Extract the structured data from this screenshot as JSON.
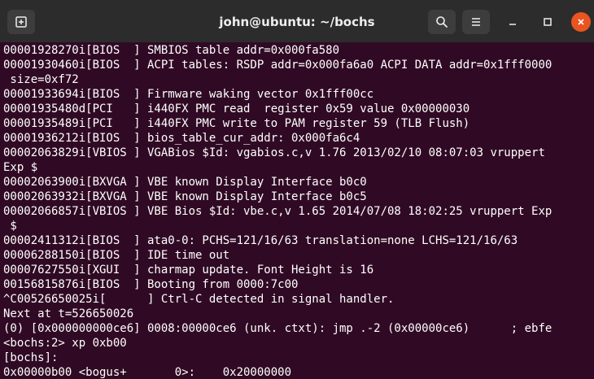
{
  "window": {
    "title": "john@ubuntu: ~/bochs",
    "accent_close": "#e95420",
    "background": "#300a24",
    "titlebar_background": "#2c2c2c"
  },
  "titlebar": {
    "buttons": [
      {
        "name": "new-tab-button",
        "icon": "new-tab-icon"
      },
      {
        "name": "search-button",
        "icon": "search-icon"
      },
      {
        "name": "hamburger-menu-button",
        "icon": "hamburger-menu-icon"
      },
      {
        "name": "minimize-button",
        "icon": "minimize-icon"
      },
      {
        "name": "maximize-button",
        "icon": "maximize-icon"
      },
      {
        "name": "close-button",
        "icon": "close-icon"
      }
    ]
  },
  "terminal": {
    "lines": [
      "00001928270i[BIOS  ] SMBIOS table addr=0x000fa580",
      "00001930460i[BIOS  ] ACPI tables: RSDP addr=0x000fa6a0 ACPI DATA addr=0x1fff0000",
      " size=0xf72",
      "00001933694i[BIOS  ] Firmware waking vector 0x1fff00cc",
      "00001935480d[PCI   ] i440FX PMC read  register 0x59 value 0x00000030",
      "00001935489i[PCI   ] i440FX PMC write to PAM register 59 (TLB Flush)",
      "00001936212i[BIOS  ] bios_table_cur_addr: 0x000fa6c4",
      "00002063829i[VBIOS ] VGABios $Id: vgabios.c,v 1.76 2013/02/10 08:07:03 vruppert",
      "Exp $",
      "00002063900i[BXVGA ] VBE known Display Interface b0c0",
      "00002063932i[BXVGA ] VBE known Display Interface b0c5",
      "00002066857i[VBIOS ] VBE Bios $Id: vbe.c,v 1.65 2014/07/08 18:02:25 vruppert Exp",
      " $",
      "00002411312i[BIOS  ] ata0-0: PCHS=121/16/63 translation=none LCHS=121/16/63",
      "00006288150i[BIOS  ] IDE time out",
      "00007627550i[XGUI  ] charmap update. Font Height is 16",
      "00156815876i[BIOS  ] Booting from 0000:7c00",
      "^C00526650025i[      ] Ctrl-C detected in signal handler.",
      "Next at t=526650026",
      "(0) [0x000000000ce6] 0008:00000ce6 (unk. ctxt): jmp .-2 (0x00000ce6)      ; ebfe",
      "<bochs:2> xp 0xb00",
      "[bochs]:",
      "0x00000b00 <bogus+       0>:    0x20000000"
    ]
  }
}
